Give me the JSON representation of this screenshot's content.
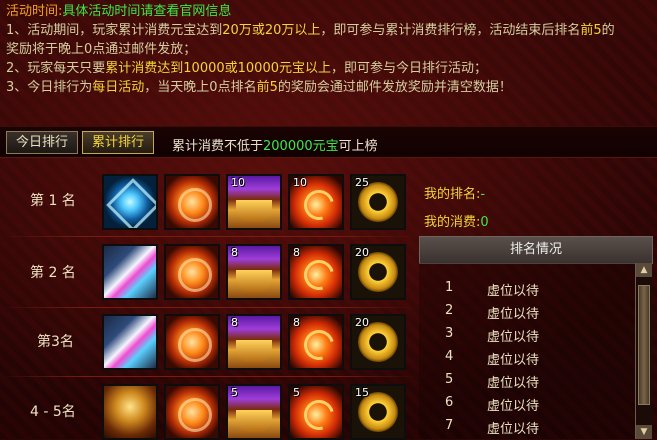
{
  "info": {
    "title_label": "活动时间:",
    "title_value": "具体活动时间请查看官网信息",
    "line1": {
      "a": "1、活动期间，玩家累计消费元宝达到",
      "b": "20万或20万以上",
      "c": "，即可参与累计消费排行榜，活动结束后排名",
      "d": "前5",
      "e": "的"
    },
    "line1_cont": "奖励将于晚上0点通过邮件发放；",
    "line2": {
      "a": "2、玩家每天只要",
      "b": "累计消费达到10000或10000元宝以上",
      "c": "，即可参与今日排行活动；"
    },
    "line3": {
      "a": "3、今日排行为",
      "b": "每日活动",
      "c": "，当天晚上0点排名",
      "d": "前5",
      "e": "的奖励会通过邮件发放奖励并清空数据！"
    }
  },
  "tabs": {
    "today": "今日排行",
    "cumulative": "累计排行",
    "note_a": "累计消费不低于",
    "note_b": "200000元宝",
    "note_c": "可上榜"
  },
  "rewards": [
    {
      "rank": "第 1 名",
      "items": [
        {
          "icon": "crystal-wing-icon",
          "qty": ""
        },
        {
          "icon": "fire-rune-icon",
          "qty": ""
        },
        {
          "icon": "cauldron-icon",
          "qty": "10"
        },
        {
          "icon": "fire-orb-icon",
          "qty": "10"
        },
        {
          "icon": "gold-ring-icon",
          "qty": "25"
        }
      ]
    },
    {
      "rank": "第 2 名",
      "items": [
        {
          "icon": "feather-wing-icon",
          "qty": ""
        },
        {
          "icon": "fire-rune-icon",
          "qty": ""
        },
        {
          "icon": "cauldron-icon",
          "qty": "8"
        },
        {
          "icon": "fire-orb-icon",
          "qty": "8"
        },
        {
          "icon": "gold-ring-icon",
          "qty": "20"
        }
      ]
    },
    {
      "rank": "第3名",
      "items": [
        {
          "icon": "feather-wing-icon",
          "qty": ""
        },
        {
          "icon": "fire-rune-icon",
          "qty": ""
        },
        {
          "icon": "cauldron-icon",
          "qty": "8"
        },
        {
          "icon": "fire-orb-icon",
          "qty": "8"
        },
        {
          "icon": "gold-ring-icon",
          "qty": "20"
        }
      ]
    },
    {
      "rank": "4 - 5名",
      "items": [
        {
          "icon": "general-portrait-icon",
          "qty": ""
        },
        {
          "icon": "fire-rune-icon",
          "qty": ""
        },
        {
          "icon": "cauldron-icon",
          "qty": "5"
        },
        {
          "icon": "fire-orb-icon",
          "qty": "5"
        },
        {
          "icon": "gold-ring-icon",
          "qty": "15"
        }
      ]
    }
  ],
  "my_info": {
    "rank_label": "我的排名:",
    "rank_value": "-",
    "spend_label": "我的消费:",
    "spend_value": "0"
  },
  "ranking_panel": {
    "header": "排名情况",
    "entries": [
      {
        "num": "1",
        "name": "虚位以待"
      },
      {
        "num": "2",
        "name": "虚位以待"
      },
      {
        "num": "3",
        "name": "虚位以待"
      },
      {
        "num": "4",
        "name": "虚位以待"
      },
      {
        "num": "5",
        "name": "虚位以待"
      },
      {
        "num": "6",
        "name": "虚位以待"
      },
      {
        "num": "7",
        "name": "虚位以待"
      }
    ]
  },
  "colors": {
    "highlight_yellow": "#f3d53a",
    "highlight_green": "#3ee84a",
    "highlight_orange": "#f2a31f",
    "body_text": "#d6cfa0"
  }
}
